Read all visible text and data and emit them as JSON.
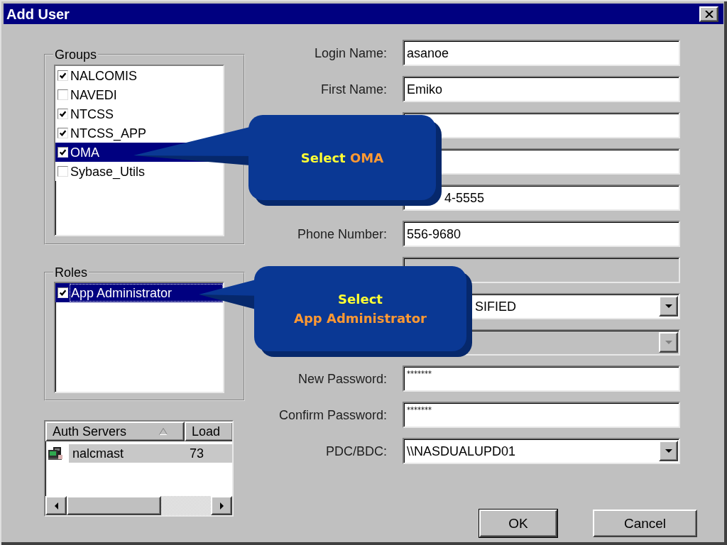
{
  "window": {
    "title": "Add User"
  },
  "groups": {
    "legend": "Groups",
    "items": [
      {
        "label": "NALCOMIS",
        "checked": true,
        "selected": false
      },
      {
        "label": "NAVEDI",
        "checked": false,
        "selected": false
      },
      {
        "label": "NTCSS",
        "checked": true,
        "selected": false
      },
      {
        "label": "NTCSS_APP",
        "checked": true,
        "selected": false
      },
      {
        "label": "OMA",
        "checked": true,
        "selected": true
      },
      {
        "label": "Sybase_Utils",
        "checked": false,
        "selected": false
      }
    ]
  },
  "roles": {
    "legend": "Roles",
    "items": [
      {
        "label": "App Administrator",
        "checked": true,
        "selected": true,
        "focused": true
      }
    ]
  },
  "auth_servers": {
    "columns": [
      {
        "label": "Auth Servers",
        "sorted": true
      },
      {
        "label": "Load",
        "sorted": false
      }
    ],
    "rows": [
      {
        "name": "nalcmast",
        "load": "73",
        "selected": true
      }
    ]
  },
  "fields": [
    {
      "kind": "text",
      "label": "Login Name:",
      "value": "asanoe",
      "disabled": false
    },
    {
      "kind": "text",
      "label": "First Name:",
      "value": "Emiko",
      "disabled": false
    },
    {
      "kind": "text",
      "disabled": false
    },
    {
      "kind": "text",
      "disabled": false
    },
    {
      "kind": "text",
      "value": "4-5555",
      "disabled": false
    },
    {
      "kind": "text",
      "label": "Phone Number:",
      "value": "556-9680",
      "disabled": false
    },
    {
      "kind": "text",
      "disabled": true
    },
    {
      "kind": "dropdown",
      "value": "SIFIED",
      "disabled": false
    },
    {
      "kind": "dropdown",
      "disabled": true
    },
    {
      "kind": "password",
      "label": "New Password:",
      "value": "*******",
      "disabled": false
    },
    {
      "kind": "password",
      "label": "Confirm Password:",
      "value": "*******",
      "disabled": false
    },
    {
      "kind": "dropdown",
      "label": "PDC/BDC:",
      "value": "\\\\NASDUALUPD01",
      "disabled": false
    }
  ],
  "buttons": [
    {
      "label": "OK",
      "default": true
    },
    {
      "label": "Cancel",
      "default": false
    }
  ],
  "callouts": [
    {
      "verb": "Select",
      "target": "OMA",
      "target_on_new_line": false
    },
    {
      "verb": "Select",
      "target": "App Administrator",
      "target_on_new_line": true
    }
  ]
}
